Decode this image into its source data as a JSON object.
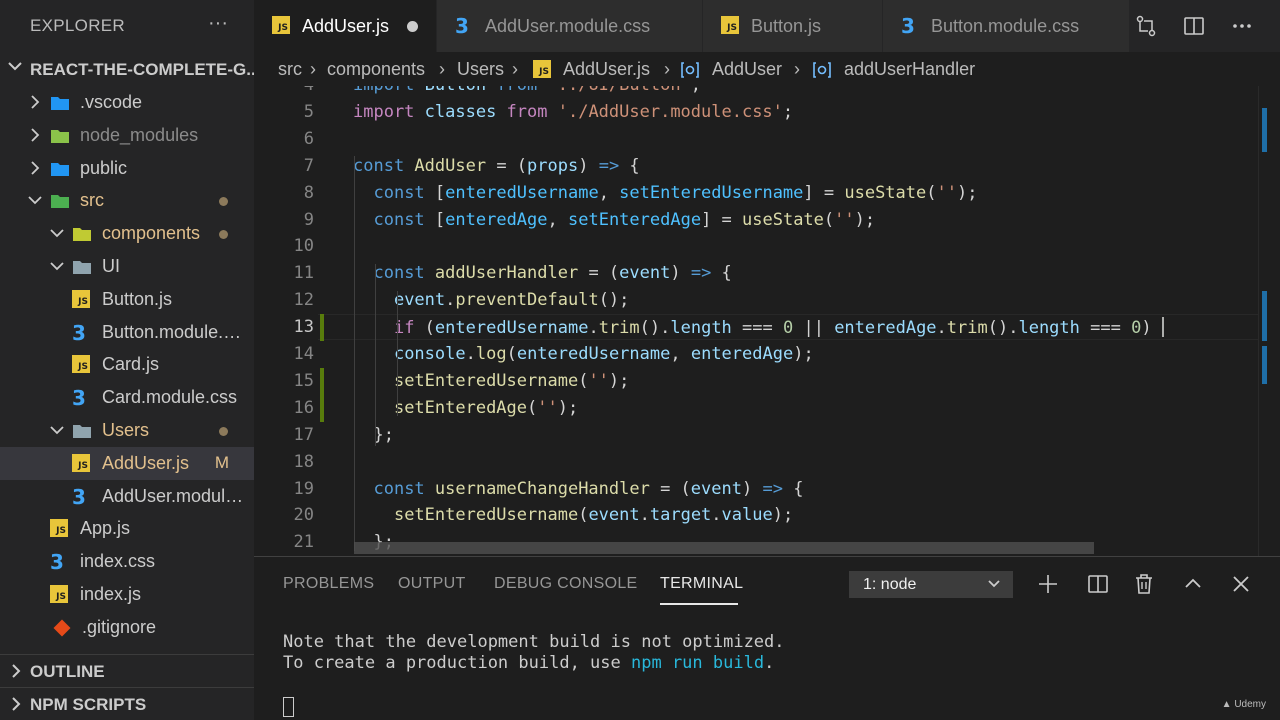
{
  "sidebar": {
    "title": "EXPLORER",
    "more_icon": "ellipsis-icon",
    "project": "REACT-THE-COMPLETE-G...",
    "items": [
      {
        "label": ".vscode",
        "icon": "vscode-folder-icon",
        "type": "folder",
        "expanded": false
      },
      {
        "label": "node_modules",
        "icon": "node-folder-icon",
        "type": "folder",
        "expanded": false
      },
      {
        "label": "public",
        "icon": "public-folder-icon",
        "type": "folder",
        "expanded": false
      },
      {
        "label": "src",
        "icon": "src-folder-icon",
        "type": "folder",
        "expanded": true
      },
      {
        "label": "components",
        "icon": "components-folder-icon",
        "type": "folder",
        "expanded": true
      },
      {
        "label": "UI",
        "icon": "folder-icon",
        "type": "folder",
        "expanded": true
      },
      {
        "label": "Button.js",
        "icon": "js-file-icon",
        "type": "file"
      },
      {
        "label": "Button.module.css",
        "icon": "css-file-icon",
        "type": "file"
      },
      {
        "label": "Card.js",
        "icon": "js-file-icon",
        "type": "file"
      },
      {
        "label": "Card.module.css",
        "icon": "css-file-icon",
        "type": "file"
      },
      {
        "label": "Users",
        "icon": "folder-icon",
        "type": "folder",
        "expanded": true
      },
      {
        "label": "AddUser.js",
        "icon": "js-file-icon",
        "type": "file",
        "status": "M"
      },
      {
        "label": "AddUser.module.css",
        "icon": "css-file-icon",
        "type": "file"
      },
      {
        "label": "App.js",
        "icon": "js-file-icon",
        "type": "file"
      },
      {
        "label": "index.css",
        "icon": "css-file-icon",
        "type": "file"
      },
      {
        "label": "index.js",
        "icon": "js-file-icon",
        "type": "file"
      },
      {
        "label": ".gitignore",
        "icon": "git-icon",
        "type": "file"
      }
    ],
    "outline": "OUTLINE",
    "npm_scripts": "NPM SCRIPTS"
  },
  "tabs": [
    {
      "label": "AddUser.js",
      "icon": "js-file-icon",
      "active": true,
      "dirty": true
    },
    {
      "label": "AddUser.module.css",
      "icon": "css-file-icon"
    },
    {
      "label": "Button.js",
      "icon": "js-file-icon"
    },
    {
      "label": "Button.module.css",
      "icon": "css-file-icon"
    }
  ],
  "editor_actions": [
    "compare-changes-icon",
    "split-editor-icon",
    "more-actions-icon"
  ],
  "breadcrumb": [
    "src",
    "components",
    "Users",
    "AddUser.js",
    "AddUser",
    "addUserHandler"
  ],
  "code": {
    "first_line": 4,
    "current_line": 13,
    "lines": [
      [
        [
          "k",
          "import "
        ],
        [
          "v",
          "Button "
        ],
        [
          "k",
          "from "
        ],
        [
          "s",
          "'../UI/Button'"
        ],
        [
          "p",
          ";"
        ]
      ],
      [
        [
          "kc",
          "import "
        ],
        [
          "v",
          "classes "
        ],
        [
          "kc",
          "from "
        ],
        [
          "s",
          "'./AddUser.module.css'"
        ],
        [
          "p",
          ";"
        ]
      ],
      [],
      [
        [
          "k",
          "const "
        ],
        [
          "f",
          "AddUser"
        ],
        [
          "p",
          " = ("
        ],
        [
          "v",
          "props"
        ],
        [
          "p",
          ") "
        ],
        [
          "k",
          "=>"
        ],
        [
          "p",
          " {"
        ]
      ],
      [
        [
          "p",
          "  "
        ],
        [
          "k",
          "const "
        ],
        [
          "p",
          "["
        ],
        [
          "c",
          "enteredUsername"
        ],
        [
          "p",
          ", "
        ],
        [
          "c",
          "setEnteredUsername"
        ],
        [
          "p",
          "] = "
        ],
        [
          "f",
          "useState"
        ],
        [
          "p",
          "("
        ],
        [
          "s",
          "''"
        ],
        [
          "p",
          ");"
        ]
      ],
      [
        [
          "p",
          "  "
        ],
        [
          "k",
          "const "
        ],
        [
          "p",
          "["
        ],
        [
          "c",
          "enteredAge"
        ],
        [
          "p",
          ", "
        ],
        [
          "c",
          "setEnteredAge"
        ],
        [
          "p",
          "] = "
        ],
        [
          "f",
          "useState"
        ],
        [
          "p",
          "("
        ],
        [
          "s",
          "''"
        ],
        [
          "p",
          ");"
        ]
      ],
      [],
      [
        [
          "p",
          "  "
        ],
        [
          "k",
          "const "
        ],
        [
          "f",
          "addUserHandler"
        ],
        [
          "p",
          " = ("
        ],
        [
          "v",
          "event"
        ],
        [
          "p",
          ") "
        ],
        [
          "k",
          "=>"
        ],
        [
          "p",
          " {"
        ]
      ],
      [
        [
          "p",
          "    "
        ],
        [
          "v",
          "event"
        ],
        [
          "p",
          "."
        ],
        [
          "f",
          "preventDefault"
        ],
        [
          "p",
          "();"
        ]
      ],
      [
        [
          "p",
          "    "
        ],
        [
          "kc",
          "if "
        ],
        [
          "p",
          "("
        ],
        [
          "v",
          "enteredUsername"
        ],
        [
          "p",
          "."
        ],
        [
          "f",
          "trim"
        ],
        [
          "p",
          "()."
        ],
        [
          "v",
          "length"
        ],
        [
          "p",
          " === "
        ],
        [
          "n",
          "0"
        ],
        [
          "p",
          " || "
        ],
        [
          "v",
          "enteredAge"
        ],
        [
          "p",
          "."
        ],
        [
          "f",
          "trim"
        ],
        [
          "p",
          "()."
        ],
        [
          "v",
          "length"
        ],
        [
          "p",
          " === "
        ],
        [
          "n",
          "0"
        ],
        [
          "p",
          ") "
        ]
      ],
      [
        [
          "p",
          "    "
        ],
        [
          "v",
          "console"
        ],
        [
          "p",
          "."
        ],
        [
          "f",
          "log"
        ],
        [
          "p",
          "("
        ],
        [
          "v",
          "enteredUsername"
        ],
        [
          "p",
          ", "
        ],
        [
          "v",
          "enteredAge"
        ],
        [
          "p",
          ");"
        ]
      ],
      [
        [
          "p",
          "    "
        ],
        [
          "f",
          "setEnteredUsername"
        ],
        [
          "p",
          "("
        ],
        [
          "s",
          "''"
        ],
        [
          "p",
          ");"
        ]
      ],
      [
        [
          "p",
          "    "
        ],
        [
          "f",
          "setEnteredAge"
        ],
        [
          "p",
          "("
        ],
        [
          "s",
          "''"
        ],
        [
          "p",
          ");"
        ]
      ],
      [
        [
          "p",
          "  };"
        ]
      ],
      [],
      [
        [
          "p",
          "  "
        ],
        [
          "k",
          "const "
        ],
        [
          "f",
          "usernameChangeHandler"
        ],
        [
          "p",
          " = ("
        ],
        [
          "v",
          "event"
        ],
        [
          "p",
          ") "
        ],
        [
          "k",
          "=>"
        ],
        [
          "p",
          " {"
        ]
      ],
      [
        [
          "p",
          "    "
        ],
        [
          "f",
          "setEnteredUsername"
        ],
        [
          "p",
          "("
        ],
        [
          "v",
          "event"
        ],
        [
          "p",
          "."
        ],
        [
          "v",
          "target"
        ],
        [
          "p",
          "."
        ],
        [
          "v",
          "value"
        ],
        [
          "p",
          ");"
        ]
      ],
      [
        [
          "p",
          "  };"
        ]
      ]
    ]
  },
  "panel": {
    "tabs": [
      "PROBLEMS",
      "OUTPUT",
      "DEBUG CONSOLE",
      "TERMINAL"
    ],
    "active_tab": "TERMINAL",
    "terminal_select": "1: node",
    "actions": [
      "add-terminal-icon",
      "split-terminal-icon",
      "trash-icon",
      "maximize-panel-icon",
      "close-panel-icon"
    ],
    "terminal_line1": "Note that the development build is not optimized.",
    "terminal_line2_prefix": "To create a production build, use ",
    "terminal_line2_cmd": "npm run build",
    "terminal_line2_suffix": "."
  },
  "watermark": "Udemy",
  "colors": {
    "accent": "#007acc",
    "modified": "#e2c08d",
    "git_added": "#587c0c"
  }
}
